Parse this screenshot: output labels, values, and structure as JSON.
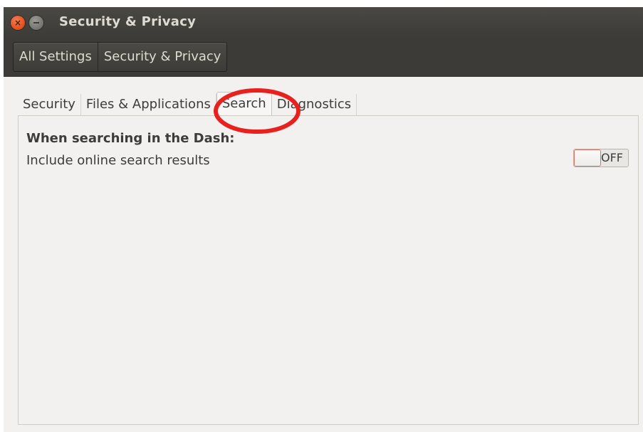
{
  "window": {
    "title": "Security & Privacy"
  },
  "breadcrumb": {
    "items": [
      "All Settings",
      "Security & Privacy"
    ]
  },
  "tabs": [
    {
      "label": "Security",
      "active": false
    },
    {
      "label": "Files & Applications",
      "active": false
    },
    {
      "label": "Search",
      "active": true
    },
    {
      "label": "Diagnostics",
      "active": false
    }
  ],
  "search_panel": {
    "heading": "When searching in the Dash:",
    "option_label": "Include online search results",
    "toggle_state": "OFF"
  },
  "colors": {
    "close_button": "#e5541f",
    "highlight_ring": "#e8211f",
    "titlebar": "#3c3b37"
  },
  "icons": {
    "close": "close-icon",
    "minimize": "minimize-icon"
  }
}
